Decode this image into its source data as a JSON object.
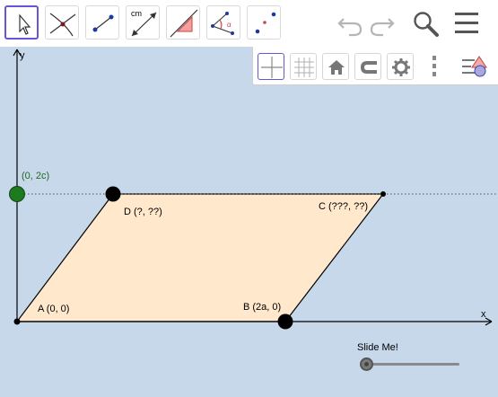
{
  "toolbar": {
    "tools": [
      {
        "name": "move-tool",
        "selected": true
      },
      {
        "name": "intersect-tool",
        "selected": false
      },
      {
        "name": "segment-tool",
        "selected": false
      },
      {
        "name": "segment-fixed-length-tool",
        "label": "cm",
        "selected": false
      },
      {
        "name": "polygon-tool",
        "selected": false
      },
      {
        "name": "angle-tool",
        "label": "α",
        "selected": false
      },
      {
        "name": "reflect-tool",
        "selected": false
      }
    ],
    "icons": [
      "undo-icon",
      "redo-icon",
      "search-icon",
      "menu-icon"
    ]
  },
  "style_bar": {
    "buttons": [
      "axes-toggle",
      "grid-toggle",
      "home-view",
      "point-capture",
      "settings",
      "more-options",
      "toggle-style-bar"
    ]
  },
  "graph": {
    "axis_x_label": "x",
    "axis_y_label": "y",
    "point_a": "A (0, 0)",
    "point_b": "B (2a, 0)",
    "point_c": "C (???, ??)",
    "point_d": "D  (?, ??)",
    "y_intercept": "(0, 2c)",
    "colors": {
      "fill": "#ffe8cc",
      "point_green": "#1e7a1e",
      "label_green": "#1e6b1e"
    }
  },
  "slider": {
    "label": "Slide Me!",
    "value": 0
  }
}
